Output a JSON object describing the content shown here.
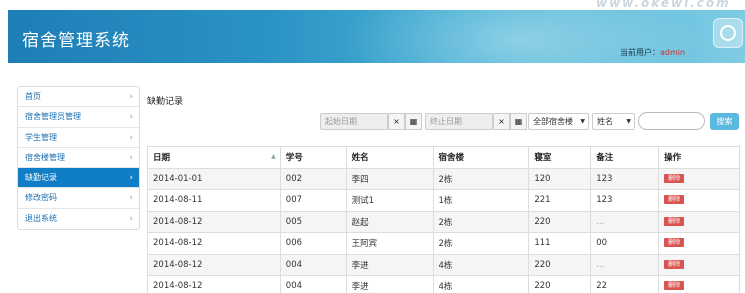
{
  "header": {
    "title": "宿舍管理系统",
    "current_user_label": "当前用户：",
    "current_user": "admin",
    "watermark": "www.okewi.com"
  },
  "sidebar": {
    "items": [
      {
        "label": "首页"
      },
      {
        "label": "宿舍管理员管理"
      },
      {
        "label": "学生管理"
      },
      {
        "label": "宿舍楼管理"
      },
      {
        "label": "缺勤记录",
        "active": true
      },
      {
        "label": "修改密码"
      },
      {
        "label": "退出系统"
      }
    ]
  },
  "main": {
    "section_title": "缺勤记录",
    "filters": {
      "start_date_placeholder": "起始日期",
      "end_date_placeholder": "终止日期",
      "clear_icon": "×",
      "calendar_icon": "▦",
      "building_select": "全部宿舍楼",
      "field_select": "姓名",
      "search_button": "搜索"
    },
    "table": {
      "columns": [
        "日期",
        "学号",
        "姓名",
        "宿舍楼",
        "寝室",
        "备注",
        "操作"
      ],
      "delete_label": "删除",
      "rows": [
        [
          "2014-01-01",
          "002",
          "李四",
          "2栋",
          "120",
          "123"
        ],
        [
          "2014-08-11",
          "007",
          "测试1",
          "1栋",
          "221",
          "123"
        ],
        [
          "2014-08-12",
          "005",
          "赵起",
          "2栋",
          "220",
          "..."
        ],
        [
          "2014-08-12",
          "006",
          "王阿宾",
          "2栋",
          "111",
          "00"
        ],
        [
          "2014-08-12",
          "004",
          "李进",
          "4栋",
          "220",
          "..."
        ],
        [
          "2014-08-12",
          "004",
          "李进",
          "4栋",
          "220",
          "22"
        ]
      ]
    }
  }
}
